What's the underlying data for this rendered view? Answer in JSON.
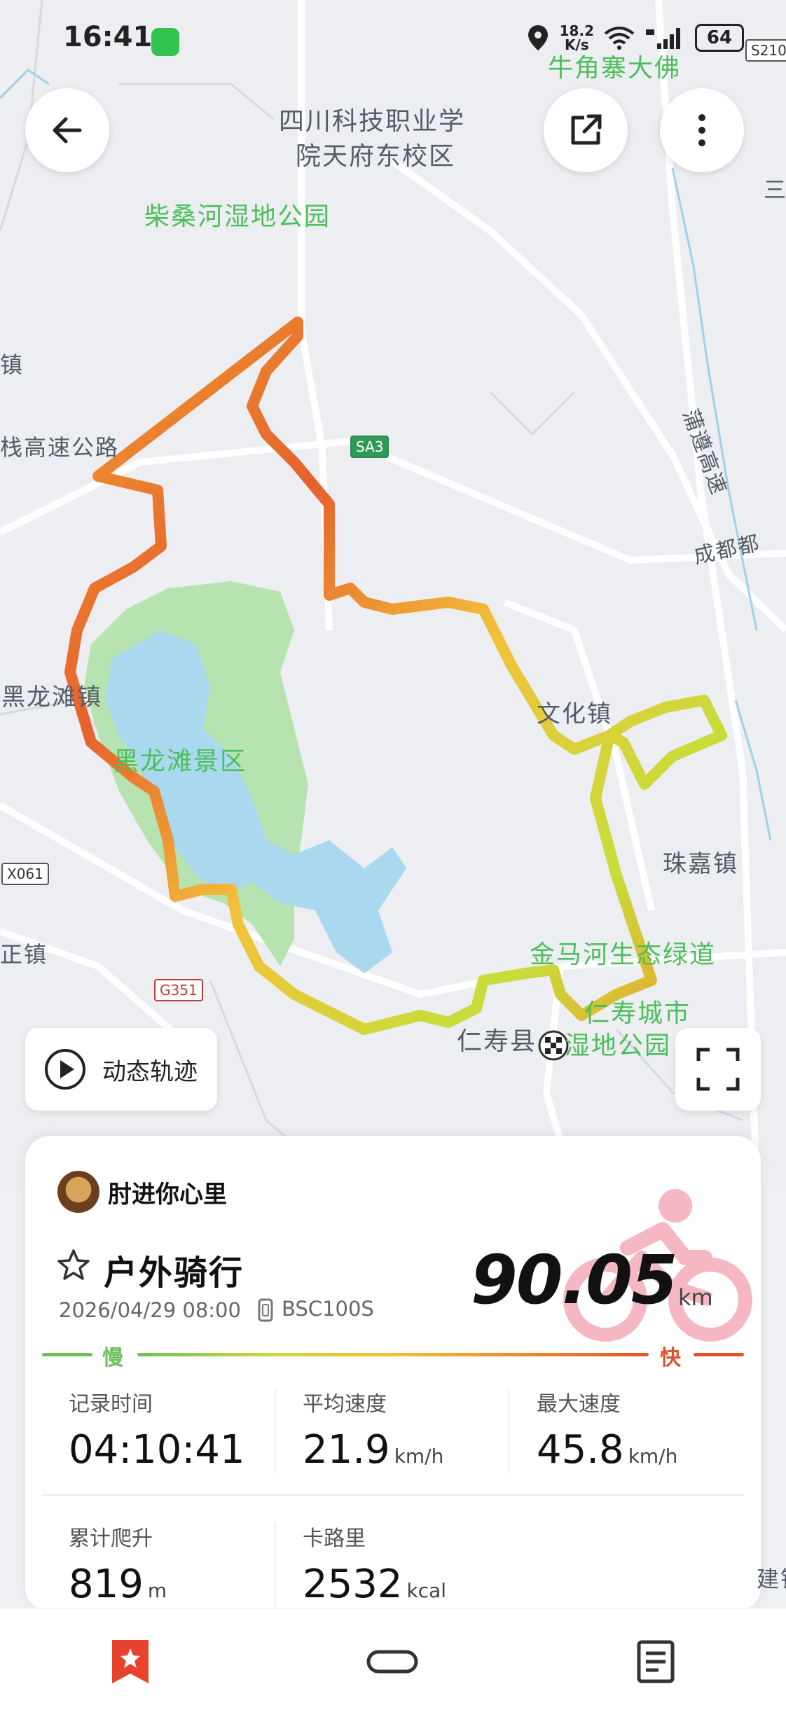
{
  "status_bar": {
    "time": "16:41",
    "net_speed_value": "18.2",
    "net_speed_unit": "K/s",
    "battery": "64"
  },
  "map": {
    "labels": {
      "niujiaozhai": "牛角寨大佛",
      "sichuan_college_l1": "四川科技职业学",
      "sichuan_college_l2": "院天府东校区",
      "chaisanghe": "柴桑河湿地公园",
      "expressway_left": "栈高速公路",
      "heilongtan_town": "黑龙滩镇",
      "heilongtan_scenic": "黑龙滩景区",
      "wenhua_town": "文化镇",
      "zhujia_town": "珠嘉镇",
      "jinmahe": "金马河生态绿道",
      "renshou_wetland_l1": "仁寿城市",
      "renshou_wetland_l2": "湿地公园",
      "renshou_county": "仁寿县",
      "chengdu_partial": "成都都",
      "puzun_highway": "蒲遵高速",
      "zheng_town": "正镇",
      "left_town_partial": "镇",
      "right_edge_partial": "三",
      "bottom_right_partial": "建镇"
    },
    "shields": {
      "s210": "S210",
      "sa3": "SA3",
      "x061": "X061",
      "g351": "G351"
    }
  },
  "controls": {
    "dynamic_track_label": "动态轨迹"
  },
  "icons": {
    "back": "arrow-left-icon",
    "share": "share-icon",
    "more": "more-vertical-icon",
    "play": "play-circle-icon",
    "fullscreen": "fullscreen-icon",
    "favorite": "star-outline-icon",
    "device": "watch-icon",
    "sport": "cycling-icon",
    "nav_record": "bookmark-star-icon",
    "nav_device": "band-icon",
    "nav_detail": "document-list-icon"
  },
  "summary": {
    "user_name": "肘进你心里",
    "sport_type": "户外骑行",
    "date": "2026/04/29 08:00",
    "device": "BSC100S",
    "distance": "90.05",
    "distance_unit": "km",
    "legend_slow": "慢",
    "legend_fast": "快",
    "stats": {
      "duration": {
        "label": "记录时间",
        "value": "04:10:41"
      },
      "avg_speed": {
        "label": "平均速度",
        "value": "21.9",
        "unit": "km/h"
      },
      "max_speed": {
        "label": "最大速度",
        "value": "45.8",
        "unit": "km/h"
      },
      "ascent": {
        "label": "累计爬升",
        "value": "819",
        "unit": "m"
      },
      "calories": {
        "label": "卡路里",
        "value": "2532",
        "unit": "kcal"
      }
    }
  },
  "colors": {
    "accent": "#e8432f",
    "slow": "#6cc05a",
    "fast": "#e0532a",
    "poi_green": "#4cbf5a",
    "lake": "#a9d8ef",
    "park": "#b6e3b0"
  }
}
